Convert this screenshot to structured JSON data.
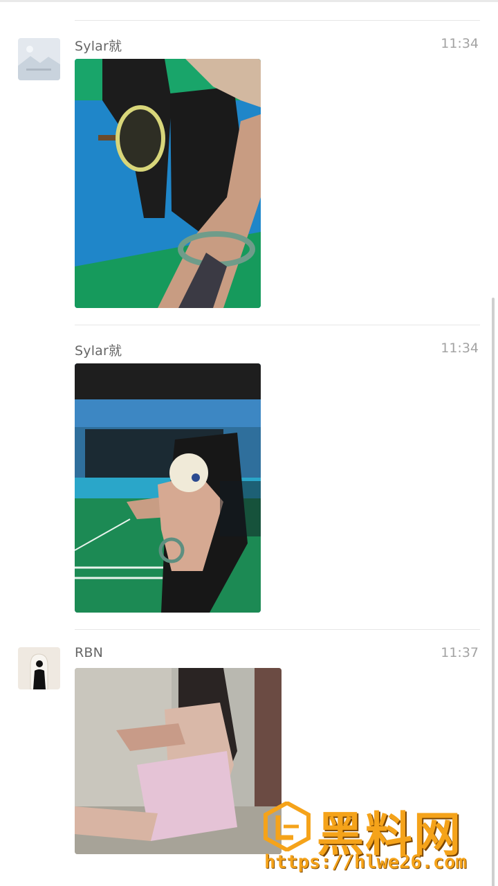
{
  "messages": [
    {
      "sender": "Sylar就",
      "time": "11:34",
      "photo": "photo-badminton-selfie"
    },
    {
      "sender": "Sylar就",
      "time": "11:34",
      "photo": "photo-shuttlecock-court"
    },
    {
      "sender": "RBN",
      "time": "11:37",
      "photo": "photo-woman-by-wall"
    }
  ],
  "watermark": {
    "brand": "黑料网",
    "url": "https://hlwe26.com"
  }
}
